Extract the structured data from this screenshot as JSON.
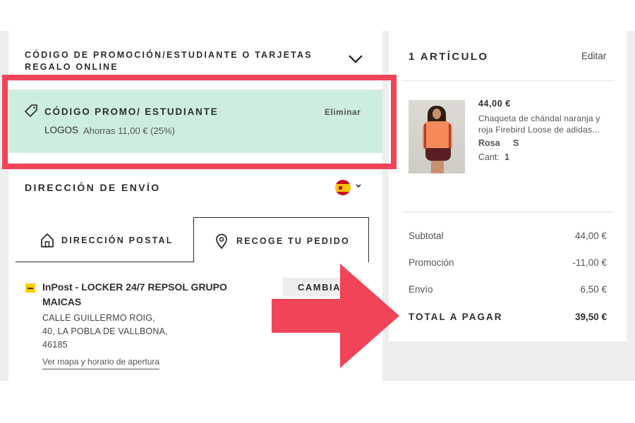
{
  "promo": {
    "section_title": "CÓDIGO DE PROMOCIÓN/ESTUDIANTE O TARJETAS REGALO ONLINE",
    "box_title": "CÓDIGO PROMO/ ESTUDIANTE",
    "remove_label": "Eliminar",
    "code": "LOGOS",
    "savings": "Ahorras 11,00 € (25%)",
    "box_color": "#cdeedf"
  },
  "shipping": {
    "title": "DIRECCIÓN DE ENVÍO",
    "country_flag": "spain-flag-icon",
    "tabs": [
      {
        "label": "DIRECCIÓN POSTAL",
        "icon": "house-icon",
        "selected": false
      },
      {
        "label": "RECOGE TU PEDIDO",
        "icon": "location-pin-icon",
        "selected": true
      }
    ],
    "pickup": {
      "name": "InPost - LOCKER 24/7 REPSOL GRUPO MAICAS",
      "change_label": "CAMBIAR",
      "address": [
        "CALLE GUILLERMO ROIG,",
        "40, LA POBLA DE VALLBONA,",
        "46185"
      ],
      "map_link": "Ver mapa y horario de apertura"
    }
  },
  "cart": {
    "count_label": "1 ARTÍCULO",
    "edit_label": "Editar",
    "item": {
      "price": "44,00 €",
      "name": "Chaqueta de chándal naranja y roja Firebird Loose de adidas...",
      "color": "Rosa",
      "size": "S",
      "qty_label": "Cant:",
      "qty": "1"
    }
  },
  "summary": {
    "subtotal_label": "Subtotal",
    "subtotal": "44,00 €",
    "promo_label": "Promoción",
    "promo": "-11,00 €",
    "shipping_label": "Envío",
    "shipping": "6,50 €",
    "total_label": "TOTAL A PAGAR",
    "total": "39,50 €"
  },
  "annotations": {
    "highlight_color": "#f24459",
    "arrow_color": "#f24459"
  }
}
